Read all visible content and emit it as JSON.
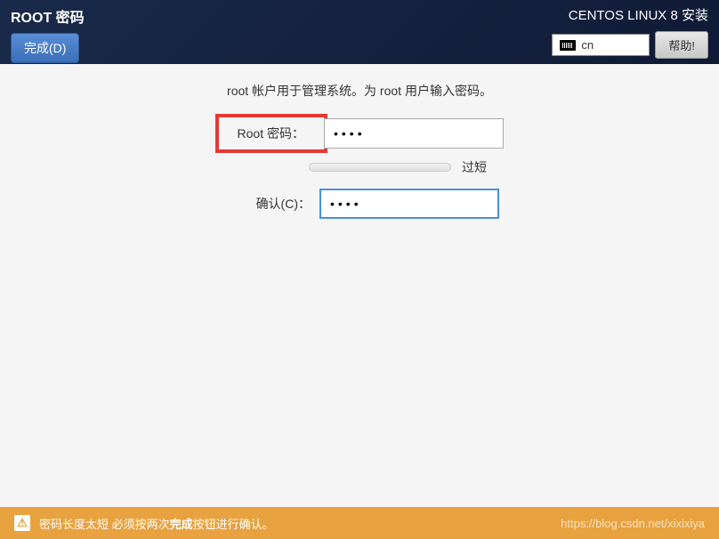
{
  "header": {
    "title": "ROOT 密码",
    "done_button": "完成(D)",
    "install_title": "CENTOS LINUX 8 安装",
    "keyboard_layout": "cn",
    "help_button": "帮助!"
  },
  "content": {
    "description": "root 帐户用于管理系统。为 root 用户输入密码。",
    "password_label": "Root 密码：",
    "password_value": "••••",
    "strength_text": "过短",
    "confirm_label": "确认(C)：",
    "confirm_value": "••••"
  },
  "warning": {
    "message_prefix": "密码长度太短 必须按两次",
    "message_bold": "完成",
    "message_suffix": "按钮进行确认。",
    "watermark": "https://blog.csdn.net/xixixiya"
  }
}
